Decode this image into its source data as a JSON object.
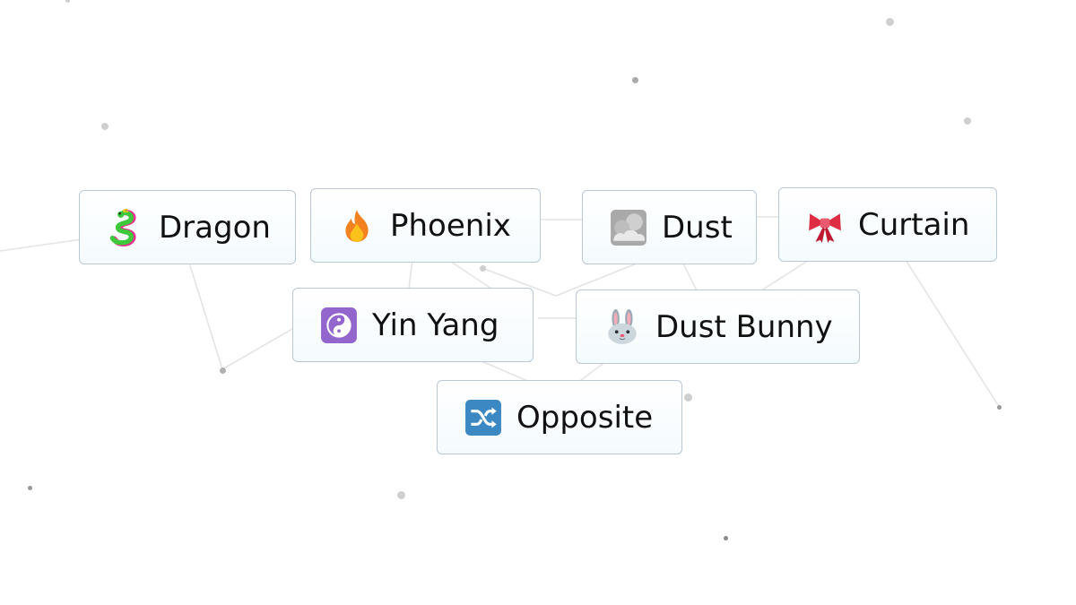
{
  "elements": [
    {
      "key": "dragon",
      "label": "Dragon",
      "icon": "dragon-icon"
    },
    {
      "key": "phoenix",
      "label": "Phoenix",
      "icon": "fire-icon"
    },
    {
      "key": "dust",
      "label": "Dust",
      "icon": "cloud-icon"
    },
    {
      "key": "curtain",
      "label": "Curtain",
      "icon": "ribbon-icon"
    },
    {
      "key": "yin-yang",
      "label": "Yin Yang",
      "icon": "yin-yang-icon"
    },
    {
      "key": "dust-bunny",
      "label": "Dust Bunny",
      "icon": "rabbit-face-icon"
    },
    {
      "key": "opposite",
      "label": "Opposite",
      "icon": "shuffle-icon"
    }
  ]
}
